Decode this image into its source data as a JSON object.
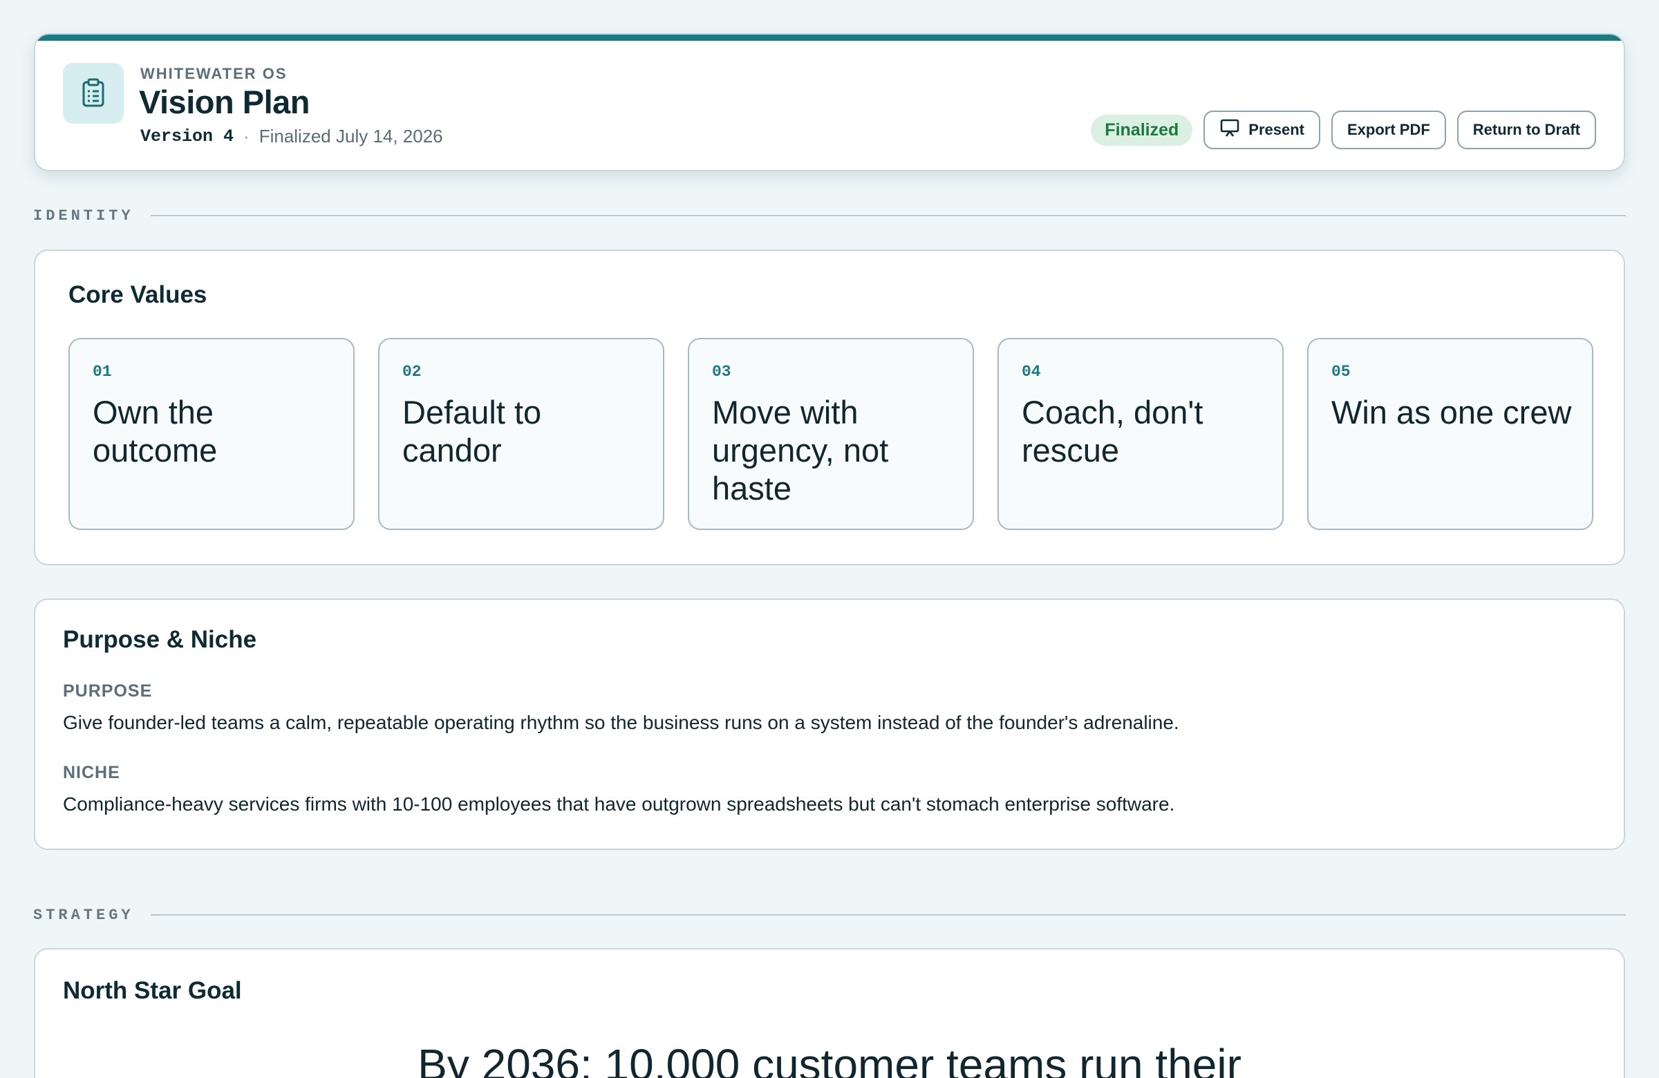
{
  "header": {
    "app_name": "WHITEWATER OS",
    "title": "Vision Plan",
    "version": "Version 4",
    "separator": "·",
    "finalized_text": "Finalized July 14, 2026",
    "status_badge": "Finalized",
    "actions": {
      "present_label": "Present",
      "export_label": "Export PDF",
      "return_label": "Return to Draft"
    },
    "app_icon": "clipboard-icon",
    "present_icon": "presentation-icon",
    "accent_color": "#1d7a80"
  },
  "sections": {
    "identity": "IDENTITY",
    "strategy": "STRATEGY"
  },
  "core_values": {
    "title": "Core Values",
    "items": [
      {
        "num": "01",
        "text": "Own the outcome"
      },
      {
        "num": "02",
        "text": "Default to candor"
      },
      {
        "num": "03",
        "text": "Move with urgency, not haste"
      },
      {
        "num": "04",
        "text": "Coach, don't rescue"
      },
      {
        "num": "05",
        "text": "Win as one crew"
      }
    ]
  },
  "purpose_niche": {
    "title": "Purpose & Niche",
    "purpose_label": "PURPOSE",
    "purpose_text": "Give founder-led teams a calm, repeatable operating rhythm so the business runs on a system instead of the founder's adrenaline.",
    "niche_label": "NICHE",
    "niche_text": "Compliance-heavy services firms with 10-100 employees that have outgrown spreadsheets but can't stomach enterprise software."
  },
  "north_star": {
    "title": "North Star Goal",
    "text": "By 2036: 10,000 customer teams run their"
  }
}
